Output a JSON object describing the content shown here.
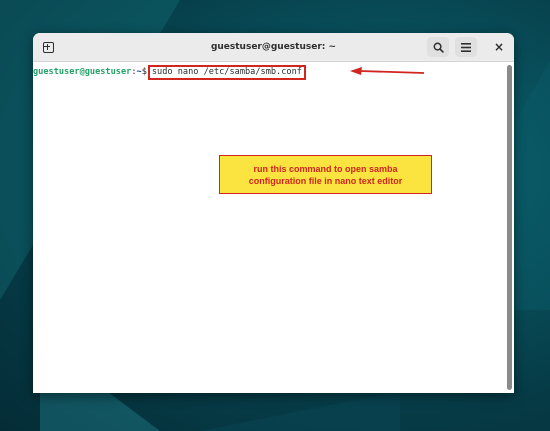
{
  "window": {
    "title": "guestuser@guestuser: ~"
  },
  "titlebar": {
    "new_tab_icon": "new-tab-icon",
    "search_icon": "search-icon",
    "menu_icon": "hamburger-menu-icon",
    "close_label": "×"
  },
  "terminal": {
    "prompt_user": "guestuser@guestuser",
    "prompt_sep": ":",
    "prompt_path": "~",
    "prompt_symbol": "$",
    "command": "sudo nano /etc/samba/smb.conf"
  },
  "annotation": {
    "line1": "run this command to open samba",
    "line2": "configuration file in nano text editor"
  },
  "colors": {
    "accent_red": "#d0261f",
    "callout_yellow": "#fbe43f",
    "prompt_green": "#26a269",
    "prompt_blue": "#12488b"
  }
}
